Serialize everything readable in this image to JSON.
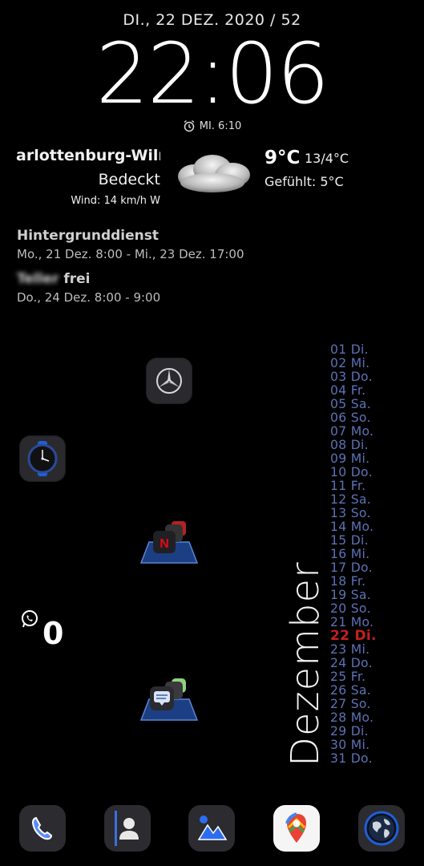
{
  "status": {
    "date_line": "DI., 22 DEZ. 2020 / 52",
    "clock": "22:06",
    "alarm": "MI. 6:10"
  },
  "weather": {
    "location": "arlottenburg-Wilr",
    "condition": "Bedeckt",
    "wind": "Wind: 14 km/h W",
    "temperature": "9°C",
    "range": "13/4°C",
    "feels_like": "Gefühlt: 5°C",
    "icon": "cloud-icon"
  },
  "events": [
    {
      "title": "Hintergrunddienst",
      "time": "Mo., 21 Dez. 8:00 - Mi., 23 Dez. 17:00"
    },
    {
      "title_blurred": "Teller",
      "title_suffix": "frei",
      "time": "Do., 24 Dez. 8:00 - 9:00"
    }
  ],
  "home_icons": {
    "mercedes": "mercedes-app-icon",
    "watch": "watch-app-icon",
    "folder1": "netflix-folder-icon",
    "folder2": "messages-folder-icon"
  },
  "whatsapp": {
    "count": "0"
  },
  "calendar": {
    "month": "Dezember",
    "days": [
      "01 Di.",
      "02 Mi.",
      "03 Do.",
      "04 Fr.",
      "05 Sa.",
      "06 So.",
      "07 Mo.",
      "08 Di.",
      "09 Mi.",
      "10 Do.",
      "11 Fr.",
      "12 Sa.",
      "13 So.",
      "14 Mo.",
      "15 Di.",
      "16 Mi.",
      "17 Do.",
      "18 Fr.",
      "19 Sa.",
      "20 So.",
      "21 Mo.",
      "22 Di.",
      "23 Mi.",
      "24 Do.",
      "25 Fr.",
      "26 Sa.",
      "27 So.",
      "28 Mo.",
      "29 Di.",
      "30 Mi.",
      "31 Do."
    ],
    "today_index": 21,
    "day_color": "#5d72b5",
    "today_color": "#c42020"
  },
  "dock": [
    "phone-icon",
    "contacts-icon",
    "gallery-icon",
    "maps-icon",
    "globe-icon"
  ]
}
